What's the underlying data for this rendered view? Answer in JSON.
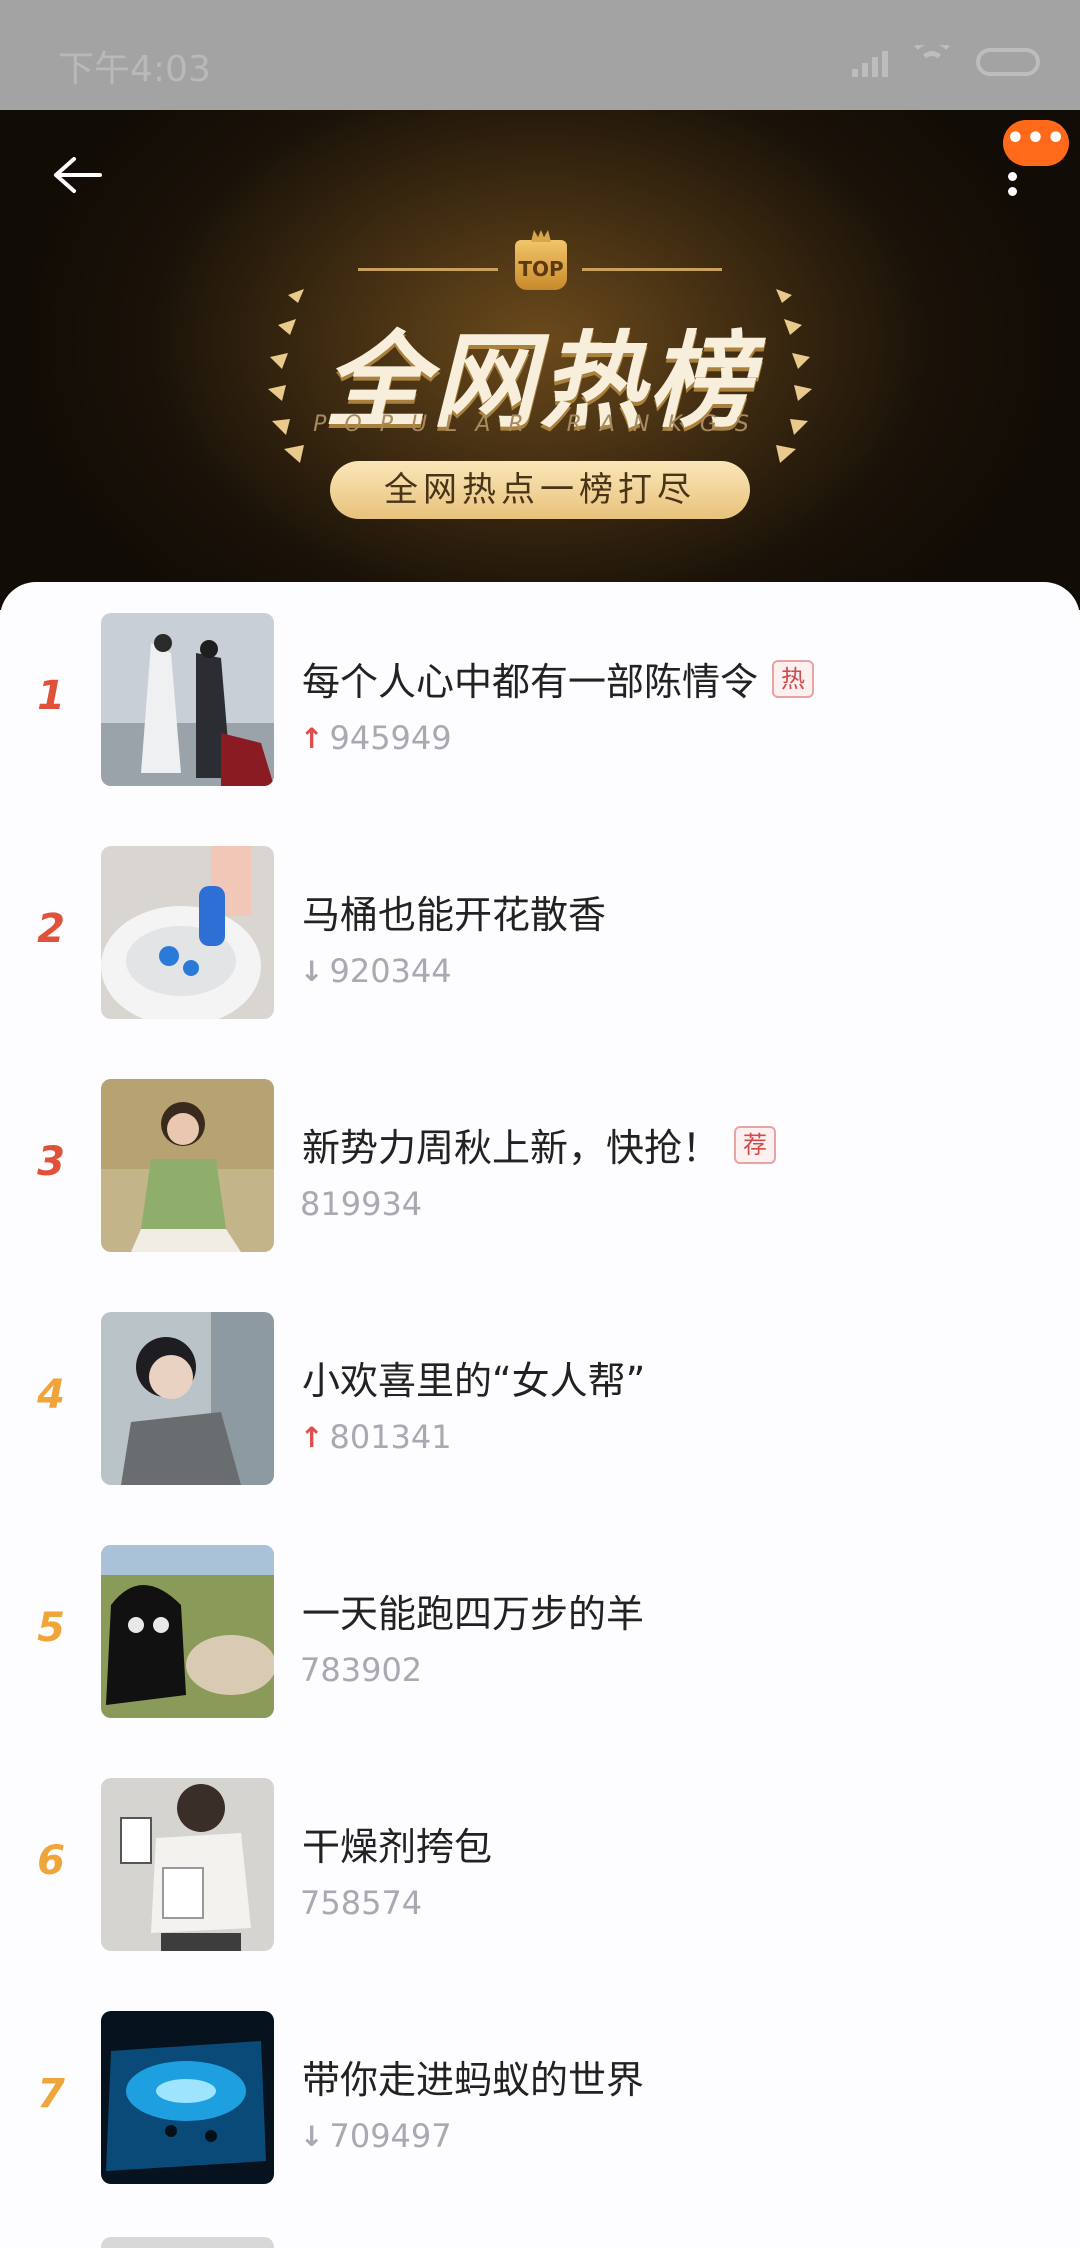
{
  "status_bar": {
    "time": "下午4:03"
  },
  "header": {
    "more_badge": "•••",
    "top_badge": "TOP",
    "title": "全网热榜",
    "subtitle": "POPULAR RANKGS",
    "slogan": "全网热点一榜打尽"
  },
  "colors": {
    "rank_top": "#e0513a",
    "rank_other": "#f0a53a",
    "tag": "#d24a4a",
    "accent": "#ff6a1a"
  },
  "items": [
    {
      "rank": "1",
      "title": "每个人心中都有一部陈情令",
      "tag": "热",
      "trend": "up",
      "score": "945949"
    },
    {
      "rank": "2",
      "title": "马桶也能开花散香",
      "tag": "",
      "trend": "down",
      "score": "920344"
    },
    {
      "rank": "3",
      "title": "新势力周秋上新，快抢！",
      "tag": "荐",
      "trend": "none",
      "score": "819934"
    },
    {
      "rank": "4",
      "title": "小欢喜里的“女人帮”",
      "tag": "",
      "trend": "up",
      "score": "801341"
    },
    {
      "rank": "5",
      "title": "一天能跑四万步的羊",
      "tag": "",
      "trend": "none",
      "score": "783902"
    },
    {
      "rank": "6",
      "title": "干燥剂挎包",
      "tag": "",
      "trend": "none",
      "score": "758574"
    },
    {
      "rank": "7",
      "title": "带你走进蚂蚁的世界",
      "tag": "",
      "trend": "down",
      "score": "709497"
    }
  ]
}
